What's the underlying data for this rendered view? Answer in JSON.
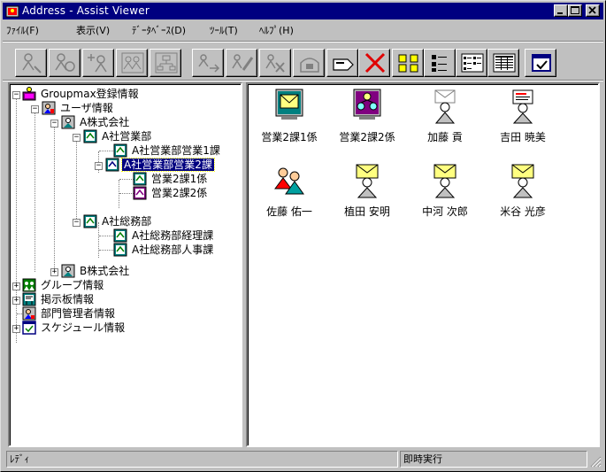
{
  "window": {
    "title": "Address - Assist Viewer"
  },
  "menu": [
    {
      "label": "ﾌｧｲﾙ(F)"
    },
    {
      "label": "表示(V)"
    },
    {
      "label": "ﾃﾞｰﾀﾍﾞｰｽ(D)"
    },
    {
      "label": "ﾂｰﾙ(T)"
    },
    {
      "label": "ﾍﾙﾌﾟ(H)"
    }
  ],
  "toolbar": [
    {
      "icon": "user-search-icon"
    },
    {
      "icon": "user-add-icon"
    },
    {
      "icon": "user-new-icon"
    },
    {
      "icon": "group-icon"
    },
    {
      "icon": "org-chart-icon"
    },
    {
      "icon": "move-icon"
    },
    {
      "icon": "edit-icon"
    },
    {
      "icon": "delete-user-icon"
    },
    {
      "icon": "mailbox-icon"
    },
    {
      "icon": "card-icon"
    },
    {
      "icon": "delete-icon"
    },
    {
      "icon": "large-icons-view-icon"
    },
    {
      "icon": "small-icons-view-icon"
    },
    {
      "icon": "list-view-icon"
    },
    {
      "icon": "details-view-icon"
    },
    {
      "icon": "immediate-execute-icon"
    }
  ],
  "tree": {
    "root": "Groupmax登録情報",
    "user_info": "ユーザ情報",
    "company_a": "A株式会社",
    "sales_dept": "A社営業部",
    "sales_sec1": "A社営業部営業1課",
    "sales_sec2": "A社営業部営業2課",
    "sec2_group1": "営業2課1係",
    "sec2_group2": "営業2課2係",
    "general_dept": "A社総務部",
    "accounting": "A社総務部経理課",
    "hr": "A社総務部人事課",
    "company_b": "B株式会社",
    "group_info": "グループ情報",
    "bbs_info": "掲示板情報",
    "dept_admin": "部門管理者情報",
    "schedule_info": "スケジュール情報"
  },
  "list": [
    {
      "label": "営業2課1係",
      "icon": "group-mail-icon"
    },
    {
      "label": "営業2課2係",
      "icon": "group-org-icon"
    },
    {
      "label": "加藤 貢",
      "icon": "user-envelope-icon"
    },
    {
      "label": "吉田 暁美",
      "icon": "user-card-icon"
    },
    {
      "label": "佐藤 佑一",
      "icon": "users-pair-icon"
    },
    {
      "label": "植田 安明",
      "icon": "user-mail-icon"
    },
    {
      "label": "中河 次郎",
      "icon": "user-mail-icon"
    },
    {
      "label": "米谷 光彦",
      "icon": "user-mail-icon"
    }
  ],
  "status": {
    "left": "ﾚﾃﾞｨ",
    "right": "即時実行"
  },
  "colors": {
    "titlebar": "#000080",
    "face": "#c0c0c0",
    "selection": "#000080"
  }
}
